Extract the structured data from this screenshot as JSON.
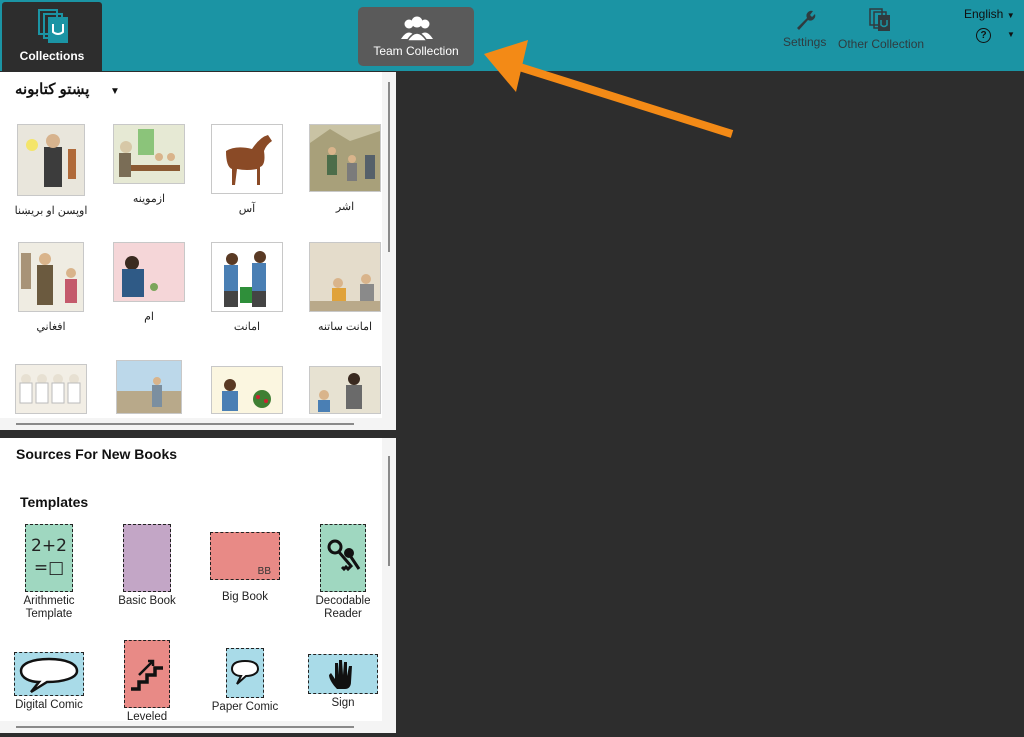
{
  "header": {
    "collections_tab": "Collections",
    "team_collection": "Team Collection",
    "settings": "Settings",
    "other_collection": "Other Collection",
    "language": "English",
    "help": "?",
    "accent": "#1b94a4"
  },
  "collection": {
    "title": "پښتو کتابونه",
    "books": [
      {
        "label": "اوپسن او بريښنا"
      },
      {
        "label": "ازموينه"
      },
      {
        "label": "آس"
      },
      {
        "label": "اشر"
      },
      {
        "label": "افغاني"
      },
      {
        "label": "ام"
      },
      {
        "label": "امانت"
      },
      {
        "label": "امانت ساتنه"
      },
      {
        "label": ""
      },
      {
        "label": ""
      },
      {
        "label": ""
      },
      {
        "label": ""
      }
    ]
  },
  "sources": {
    "title": "Sources For New Books",
    "templates_title": "Templates",
    "templates": [
      {
        "label": "Arithmetic Template",
        "icon": "arithmetic-icon",
        "color": "#9fd7c0",
        "text": "2+2\n=□"
      },
      {
        "label": "Basic Book",
        "icon": "basic-book-icon",
        "color": "#c3a6c6"
      },
      {
        "label": "Big Book",
        "icon": "big-book-icon",
        "color": "#e88a86",
        "text": "BB"
      },
      {
        "label": "Decodable Reader",
        "icon": "keys-icon",
        "color": "#9fd7c0"
      },
      {
        "label": "Digital Comic",
        "icon": "speech-bubble-icon",
        "color": "#a9dbe8"
      },
      {
        "label": "Leveled",
        "icon": "stairs-icon",
        "color": "#e88a86"
      },
      {
        "label": "Paper Comic",
        "icon": "speech-bubble-icon",
        "color": "#a9dbe8"
      },
      {
        "label": "Sign",
        "icon": "hand-icon",
        "color": "#a9dbe8"
      }
    ]
  }
}
